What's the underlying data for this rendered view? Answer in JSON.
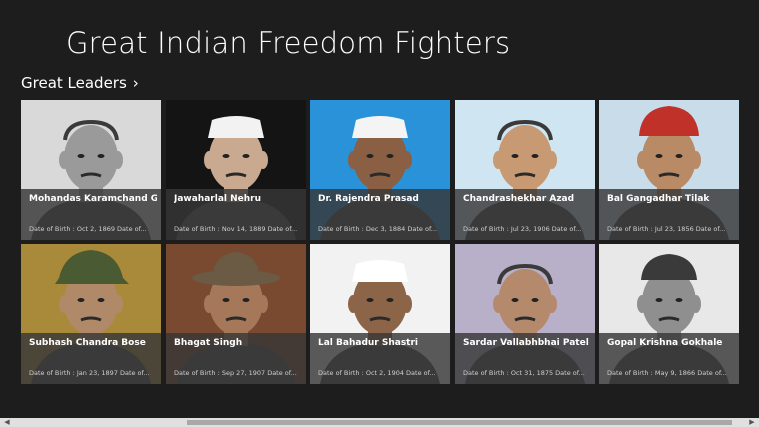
{
  "app": {
    "title": "Great Indian Freedom Fighters"
  },
  "section": {
    "title": "Great Leaders",
    "chevron": "›"
  },
  "tiles": [
    {
      "name": "Mohandas Karamchand Gandhi",
      "dob": "Date of Birth : Oct 2, 1869 Date of...",
      "bg": "#d9d9d9",
      "cap": "none",
      "capColor": "#ffffff",
      "skin": "#9a9a9a"
    },
    {
      "name": "Jawaharlal Nehru",
      "dob": "Date of Birth : Nov 14, 1889 Date of...",
      "bg": "#141414",
      "cap": "gandhi",
      "capColor": "#f2f2f2",
      "skin": "#c9a98f"
    },
    {
      "name": "Dr. Rajendra Prasad",
      "dob": "Date of Birth : Dec 3, 1884 Date of...",
      "bg": "#2a92d8",
      "cap": "gandhi",
      "capColor": "#f4f4f4",
      "skin": "#8a5f43"
    },
    {
      "name": "Chandrashekhar Azad",
      "dob": "Date of Birth : Jul 23, 1906 Date of...",
      "bg": "#cfe6f2",
      "cap": "none",
      "capColor": "#000000",
      "skin": "#c79a73"
    },
    {
      "name": "Bal Gangadhar Tilak",
      "dob": "Date of Birth : Jul 23, 1856 Date of...",
      "bg": "#c8dcea",
      "cap": "turban",
      "capColor": "#c0312a",
      "skin": "#b98a66"
    },
    {
      "name": "Subhash Chandra Bose",
      "dob": "Date of Birth : Jan 23, 1897 Date of...",
      "bg": "#a88a3a",
      "cap": "military",
      "capColor": "#4a5a33",
      "skin": "#b08968"
    },
    {
      "name": "Bhagat Singh",
      "dob": "Date of Birth : Sep 27, 1907 Date of...",
      "bg": "#7a4a30",
      "cap": "hat",
      "capColor": "#6b5a44",
      "skin": "#a6785a"
    },
    {
      "name": "Lal Bahadur Shastri",
      "dob": "Date of Birth : Oct 2, 1904 Date of...",
      "bg": "#f2f2f2",
      "cap": "gandhi",
      "capColor": "#ffffff",
      "skin": "#8c6448"
    },
    {
      "name": "Sardar Vallabhbhai Patel",
      "dob": "Date of Birth : Oct 31, 1875 Date of...",
      "bg": "#b8b0c8",
      "cap": "none",
      "capColor": "#000000",
      "skin": "#b58a6c"
    },
    {
      "name": "Gopal Krishna Gokhale",
      "dob": "Date of Birth : May 9, 1866 Date of...",
      "bg": "#e8e8e8",
      "cap": "pagdi",
      "capColor": "#3a3a3a",
      "skin": "#8f8f8f"
    }
  ],
  "scrollbar": {
    "left_arrow": "◀",
    "right_arrow": "▶"
  }
}
